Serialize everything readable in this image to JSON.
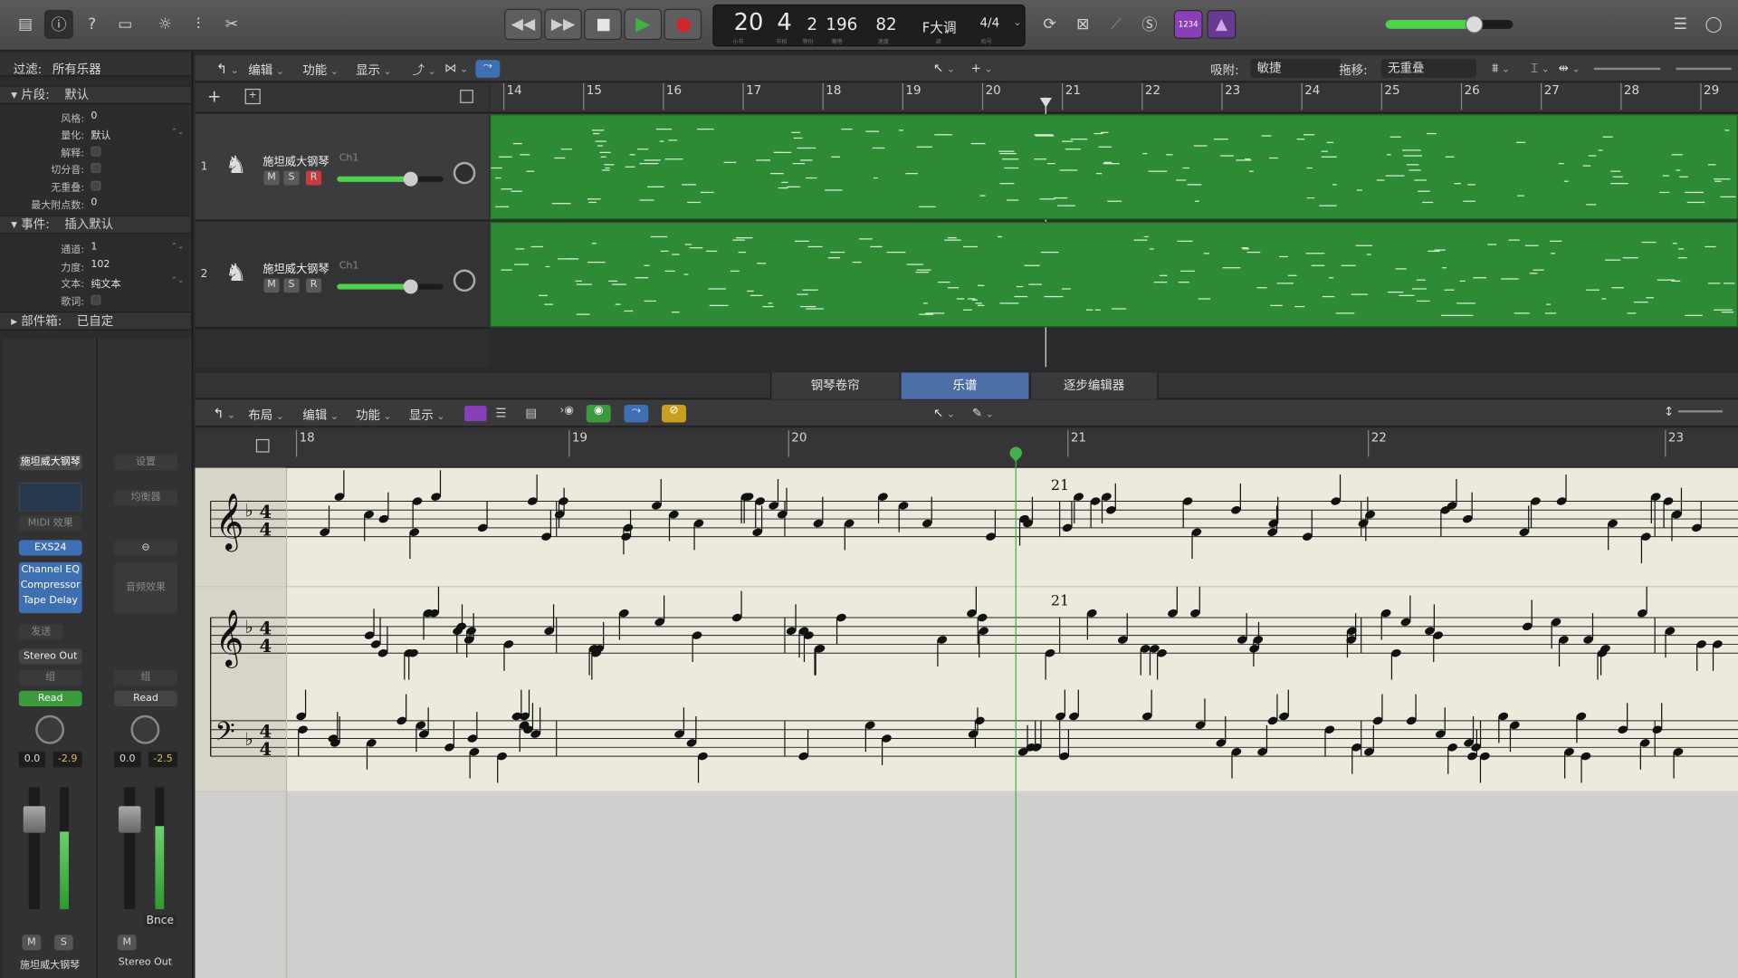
{
  "transport": {
    "bar": "20",
    "beat": "4",
    "div": "2",
    "tick": "196",
    "tempo": "82",
    "key": "F大调",
    "signature": "4/4",
    "bar_sub": "小节",
    "beat_sub": "节拍",
    "div_sub": "等份",
    "tick_sub": "嘀嗒",
    "tempo_sub": "速度",
    "key_sub": "调",
    "sig_sub": "拍号",
    "count_in": "1234"
  },
  "inspector": {
    "filter_label": "过滤:",
    "filter_value": "所有乐器",
    "region_section": "片段:",
    "region_value": "默认",
    "style_k": "风格:",
    "style_v": "0",
    "quant_k": "量化:",
    "quant_v": "默认",
    "interp_k": "解释:",
    "split_k": "切分音:",
    "nooverlap_k": "无重叠:",
    "maxdots_k": "最大附点数:",
    "maxdots_v": "0",
    "event_section": "事件:",
    "event_value": "插入默认",
    "channel_k": "通道:",
    "channel_v": "1",
    "velocity_k": "力度:",
    "velocity_v": "102",
    "text_k": "文本:",
    "text_v": "纯文本",
    "lyric_k": "歌词:",
    "parts_section": "部件箱:",
    "parts_value": "已自定"
  },
  "strip1": {
    "name": "施坦威大钢琴",
    "midi_fx": "MIDI 效果",
    "instrument": "EXS24",
    "plugins": [
      "Channel EQ",
      "Compressor",
      "Tape Delay"
    ],
    "send": "发送",
    "output": "Stereo Out",
    "group": "组",
    "automation": "Read",
    "pan": "0.0",
    "peak": "-2.9",
    "mute": "M",
    "solo": "S",
    "footer": "施坦威大钢琴"
  },
  "strip2": {
    "setting": "设置",
    "eq": "均衡器",
    "audio_fx": "音频效果",
    "group": "组",
    "automation": "Read",
    "pan": "0.0",
    "peak": "-2.5",
    "bnce": "Bnce",
    "mute": "M",
    "footer": "Stereo Out"
  },
  "tracks_toolbar": {
    "edit": "编辑",
    "function": "功能",
    "view": "显示",
    "snap_label": "吸附:",
    "snap_value": "敏捷",
    "drag_label": "拖移:",
    "drag_value": "无重叠"
  },
  "ruler_bars": [
    "14",
    "15",
    "16",
    "17",
    "18",
    "19",
    "20",
    "21",
    "22",
    "23",
    "24",
    "25",
    "26",
    "27",
    "28",
    "29"
  ],
  "tracks": [
    {
      "num": "1",
      "name": "施坦威大钢琴",
      "channel": "Ch1",
      "m": "M",
      "s": "S",
      "r": "R"
    },
    {
      "num": "2",
      "name": "施坦威大钢琴",
      "channel": "Ch1",
      "m": "M",
      "s": "S",
      "r": "R"
    }
  ],
  "editor": {
    "tabs": [
      "钢琴卷帘",
      "乐谱",
      "逐步编辑器"
    ],
    "layout": "布局",
    "edit": "编辑",
    "function": "功能",
    "view": "显示",
    "bars": [
      "18",
      "19",
      "20",
      "21",
      "22",
      "23"
    ],
    "measure_label_1": "21",
    "measure_label_2": "21"
  },
  "colors": {
    "region": "#2e8b35",
    "active_tab": "#4d6fa8",
    "record": "#d0262b",
    "play": "#3fb23f"
  }
}
